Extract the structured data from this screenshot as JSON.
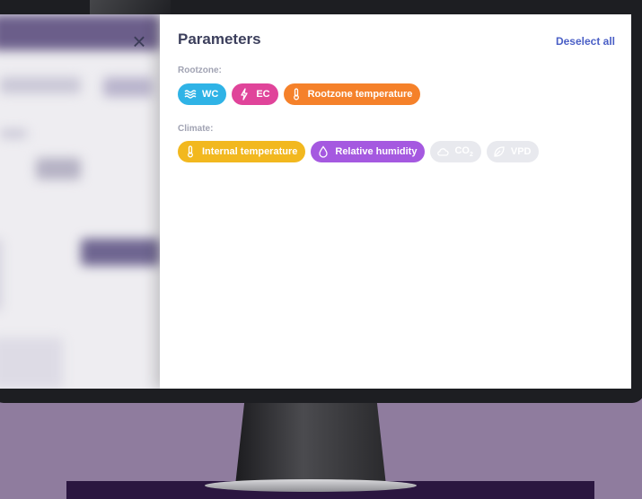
{
  "panel": {
    "title": "Parameters",
    "deselect_label": "Deselect all",
    "close_icon": "close-icon"
  },
  "groups": [
    {
      "label": "Rootzone:",
      "chips": [
        {
          "label": "WC",
          "icon": "waves-icon",
          "color": "#2fb3e6",
          "selected": true
        },
        {
          "label": "EC",
          "icon": "lightning-icon",
          "color": "#e0449a",
          "selected": true
        },
        {
          "label": "Rootzone temperature",
          "icon": "thermometer-icon",
          "color": "#f5812a",
          "selected": true
        }
      ]
    },
    {
      "label": "Climate:",
      "chips": [
        {
          "label": "Internal temperature",
          "icon": "thermometer-icon",
          "color": "#f2b81f",
          "selected": true
        },
        {
          "label": "Relative humidity",
          "icon": "droplet-icon",
          "color": "#a559e0",
          "selected": true
        },
        {
          "label": "CO",
          "sub": "2",
          "icon": "cloud-icon",
          "color": "#e8e9ee",
          "selected": false
        },
        {
          "label": "VPD",
          "icon": "leaf-icon",
          "color": "#e8e9ee",
          "selected": false
        }
      ]
    }
  ]
}
